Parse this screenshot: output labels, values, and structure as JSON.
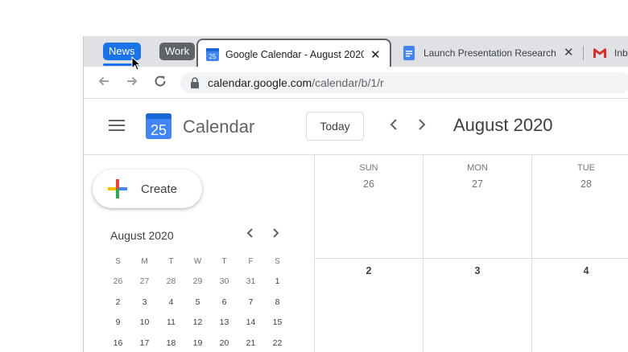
{
  "browser": {
    "tab_groups": [
      {
        "label": "News",
        "color": "#1a73e8"
      },
      {
        "label": "Work",
        "color": "#5f6368"
      }
    ],
    "tabs": [
      {
        "title": "Google Calendar - August 2020",
        "favicon": "calendar-favicon",
        "favicon_text": "25",
        "active": true
      },
      {
        "title": "Launch Presentation Research",
        "favicon": "slides-favicon",
        "active": false
      },
      {
        "title": "Inbox",
        "favicon": "gmail-favicon",
        "active": false
      }
    ],
    "close_glyph": "✕",
    "url_host": "calendar.google.com",
    "url_path": "/calendar/b/1/r"
  },
  "calendar": {
    "logo_day": "25",
    "app_name": "Calendar",
    "today_label": "Today",
    "month_title": "August 2020",
    "create_label": "Create",
    "mini": {
      "title": "August 2020",
      "weekday_heads": [
        "S",
        "M",
        "T",
        "W",
        "T",
        "F",
        "S"
      ],
      "weeks": [
        [
          {
            "d": "26",
            "muted": true
          },
          {
            "d": "27",
            "muted": true
          },
          {
            "d": "28",
            "muted": true
          },
          {
            "d": "29",
            "muted": true
          },
          {
            "d": "30",
            "muted": true
          },
          {
            "d": "31",
            "muted": true
          },
          {
            "d": "1",
            "muted": false
          }
        ],
        [
          {
            "d": "2"
          },
          {
            "d": "3"
          },
          {
            "d": "4"
          },
          {
            "d": "5"
          },
          {
            "d": "6"
          },
          {
            "d": "7"
          },
          {
            "d": "8"
          }
        ],
        [
          {
            "d": "9"
          },
          {
            "d": "10"
          },
          {
            "d": "11"
          },
          {
            "d": "12"
          },
          {
            "d": "13"
          },
          {
            "d": "14"
          },
          {
            "d": "15"
          }
        ],
        [
          {
            "d": "16"
          },
          {
            "d": "17"
          },
          {
            "d": "18"
          },
          {
            "d": "19"
          },
          {
            "d": "20"
          },
          {
            "d": "21"
          },
          {
            "d": "22"
          }
        ]
      ]
    },
    "columns": [
      {
        "day": "SUN",
        "week1": "26",
        "week2": "2"
      },
      {
        "day": "MON",
        "week1": "27",
        "week2": "3"
      },
      {
        "day": "TUE",
        "week1": "28",
        "week2": "4"
      }
    ]
  }
}
